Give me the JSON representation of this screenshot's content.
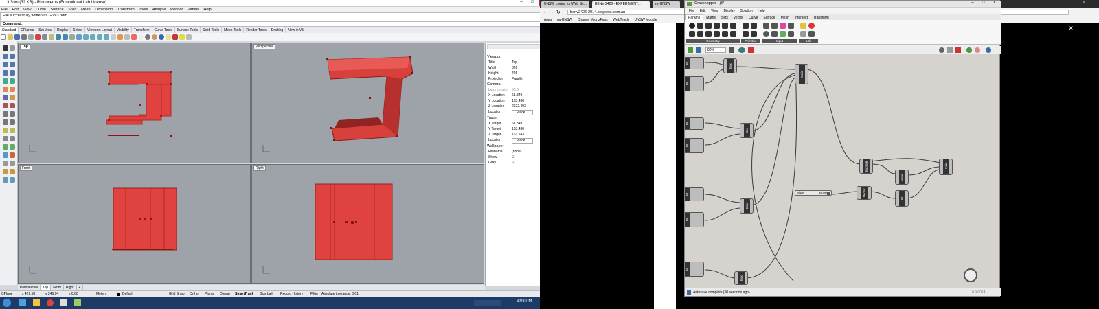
{
  "rhino": {
    "title": "3.3dm (32 KB) - Rhinoceros (Educational Lab License)",
    "menu": [
      "File",
      "Edit",
      "View",
      "Curve",
      "Surface",
      "Solid",
      "Mesh",
      "Dimension",
      "Transform",
      "Tools",
      "Analyze",
      "Render",
      "Panels",
      "Help"
    ],
    "command_history": "File successfully written as G:\\3\\3.3dm",
    "command_prompt": "Command:",
    "toolbar_tabs": [
      "Standard",
      "CPlanes",
      "Set View",
      "Display",
      "Select",
      "Viewport Layout",
      "Visibility",
      "Transform",
      "Curve Tools",
      "Surface Tools",
      "Solid Tools",
      "Mesh Tools",
      "Render Tools",
      "Drafting",
      "New in V5"
    ],
    "viewports": {
      "top": "Top",
      "perspective": "Perspective",
      "front": "Front",
      "right": "Right"
    },
    "properties": {
      "section_viewport": "Viewport",
      "rows_viewport": [
        {
          "label": "Title",
          "value": "Top"
        },
        {
          "label": "Width",
          "value": "826"
        },
        {
          "label": "Height",
          "value": "426"
        },
        {
          "label": "Projection",
          "value": "Parallel"
        }
      ],
      "section_camera": "Camera",
      "rows_camera": [
        {
          "label": "Lens Length",
          "value": "50.0"
        },
        {
          "label": "X Location",
          "value": "61.849"
        },
        {
          "label": "Y Location",
          "value": "163.430"
        },
        {
          "label": "Z Location",
          "value": "2622.493"
        },
        {
          "label": "Location",
          "value": "Place..."
        }
      ],
      "section_target": "Target",
      "rows_target": [
        {
          "label": "X Target",
          "value": "61.849"
        },
        {
          "label": "Y Target",
          "value": "163.430"
        },
        {
          "label": "Z Target",
          "value": "161.243"
        },
        {
          "label": "Location",
          "value": "Place..."
        }
      ],
      "section_wallpaper": "Wallpaper",
      "rows_wallpaper": [
        {
          "label": "Filename",
          "value": "(none)"
        },
        {
          "label": "Show",
          "value": "☑"
        },
        {
          "label": "Gray",
          "value": "☑"
        }
      ]
    },
    "viewport_tabs": [
      "Perspective",
      "Top",
      "Front",
      "Right"
    ],
    "status": {
      "cplane": "CPlane",
      "x": "x 429.58",
      "y": "y 245.94",
      "z": "z 0.00",
      "units": "Meters",
      "layer": "Default",
      "grid_snap": "Grid Snap",
      "ortho": "Ortho",
      "planar": "Planar",
      "osnap": "Osnap",
      "smarttrack": "SmartTrack",
      "gumball": "Gumball",
      "record_history": "Record History",
      "filter": "Filter",
      "tolerance": "Absolute tolerance: 0.01"
    },
    "colors": {
      "object_red": "#e0433f",
      "viewport_bg": "#9ea3a9"
    }
  },
  "taskbar": {
    "time": "3:08 PM"
  },
  "browser": {
    "tabs": [
      "UNSW Logins for Web Se...",
      "BENV 2426 - EXPERIMENT...",
      "myUNSW"
    ],
    "url": "benv2426-2014.blogspot.com.au",
    "bookmarks": [
      "Apps",
      "myUNSW",
      "Change Your zPass",
      "WebTeach",
      "UNSW Moodle"
    ]
  },
  "grasshopper": {
    "title": "Grasshopper - j3*",
    "menu": [
      "File",
      "Edit",
      "View",
      "Display",
      "Solution",
      "Help"
    ],
    "tabs": [
      "Params",
      "Maths",
      "Sets",
      "Vector",
      "Curve",
      "Surface",
      "Mesh",
      "Intersect",
      "Transform"
    ],
    "groups": [
      "Geometry",
      "Primitive",
      "Input",
      "Util"
    ],
    "zoom": "80%",
    "components": [
      "Pt",
      "Box",
      "Pt",
      "Pt",
      "Box",
      "Pt",
      "Pt",
      "Box",
      "Pt",
      "Pt",
      "Box",
      "Solid",
      "Explode",
      "Move",
      "Vector",
      "Pt",
      "Pt",
      "Unite"
    ],
    "slider": {
      "name": "Slider",
      "value": "35.000"
    },
    "status": "Autosave complete (60 seconds ago)",
    "version": "0.9.0014"
  }
}
